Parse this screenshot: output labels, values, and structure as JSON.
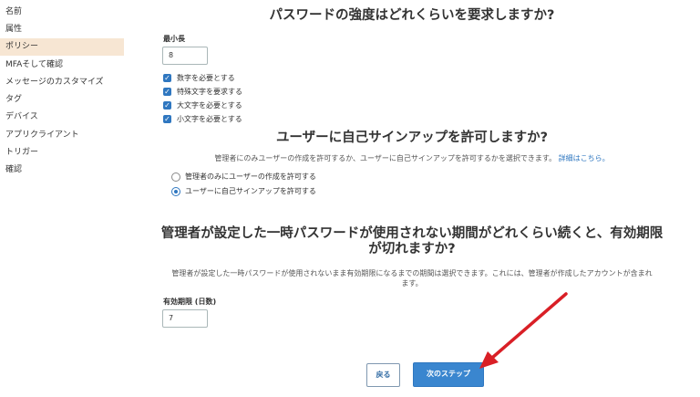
{
  "sidebar": {
    "items": [
      {
        "label": "名前",
        "active": false
      },
      {
        "label": "属性",
        "active": false
      },
      {
        "label": "ポリシー",
        "active": true
      },
      {
        "label": "MFAそして確認",
        "active": false
      },
      {
        "label": "メッセージのカスタマイズ",
        "active": false
      },
      {
        "label": "タグ",
        "active": false
      },
      {
        "label": "デバイス",
        "active": false
      },
      {
        "label": "アプリクライアント",
        "active": false
      },
      {
        "label": "トリガー",
        "active": false
      },
      {
        "label": "確認",
        "active": false
      }
    ]
  },
  "password_section": {
    "title": "パスワードの強度はどれくらいを要求しますか?",
    "min_length_label": "最小長",
    "min_length_value": "8",
    "checkboxes": [
      {
        "label": "数字を必要とする",
        "checked": true
      },
      {
        "label": "特殊文字を要求する",
        "checked": true
      },
      {
        "label": "大文字を必要とする",
        "checked": true
      },
      {
        "label": "小文字を必要とする",
        "checked": true
      }
    ]
  },
  "signup_section": {
    "title": "ユーザーに自己サインアップを許可しますか?",
    "description": "管理者にのみユーザーの作成を許可するか、ユーザーに自己サインアップを許可するかを選択できます。",
    "link": "詳細はこちら。",
    "options": [
      {
        "label": "管理者のみにユーザーの作成を許可する",
        "selected": false
      },
      {
        "label": "ユーザーに自己サインアップを許可する",
        "selected": true
      }
    ]
  },
  "expiry_section": {
    "title_line1": "管理者が設定した一時パスワードが使用されない期間がどれくらい続くと、有効期限",
    "title_line2": "が切れますか?",
    "description_line1": "管理者が設定した一時パスワードが使用されないまま有効期限になるまでの期間は選択できます。これには、管理者が作成したアカウントが含まれ",
    "description_line2": "ます。",
    "expiry_label": "有効期限 (日数)",
    "expiry_value": "7"
  },
  "buttons": {
    "back": "戻る",
    "next": "次のステップ"
  },
  "colors": {
    "accent": "#2f77c0",
    "sidebar_active": "#f7e6d3",
    "annotation_arrow": "#d91f26"
  }
}
